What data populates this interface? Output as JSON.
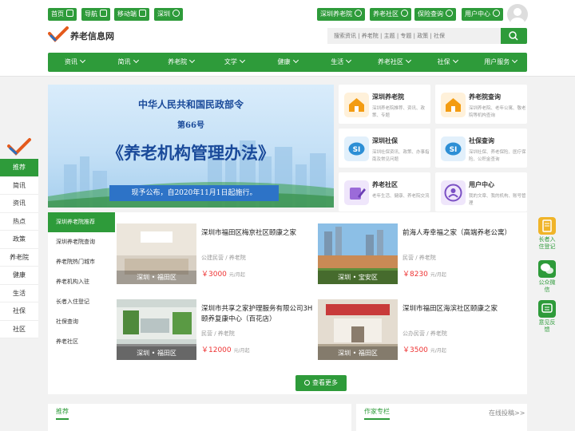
{
  "top": {
    "left_buttons": [
      {
        "label": "首页",
        "icon": "home-icon"
      },
      {
        "label": "导航",
        "icon": "grid-icon"
      },
      {
        "label": "移动端",
        "icon": "phone-icon"
      },
      {
        "label": "深圳",
        "icon": "location-icon"
      }
    ],
    "right_buttons": [
      {
        "label": "深圳养老院",
        "icon": "link-icon"
      },
      {
        "label": "养老社区",
        "icon": "link-icon"
      },
      {
        "label": "保险查询",
        "icon": "link-icon"
      },
      {
        "label": "用户中心",
        "icon": "link-icon"
      }
    ]
  },
  "logo": {
    "text": "养老信息网"
  },
  "search": {
    "placeholder": "搜索资讯 | 养老院 | 主题 | 专题 | 政策 | 社保"
  },
  "nav": [
    "资讯",
    "简讯",
    "养老院",
    "文学",
    "健康",
    "生活",
    "养老社区",
    "社保",
    "用户服务"
  ],
  "banner": {
    "line1": "中华人民共和国民政部令",
    "line2": "第66号",
    "line3": "《养老机构管理办法》",
    "line4": "现予公布，自2020年11月1日起施行。"
  },
  "cards": [
    {
      "title": "深圳养老院",
      "desc": "深圳养老院推荐、资讯、政策、专题",
      "icon": "house-icon"
    },
    {
      "title": "养老院查询",
      "desc": "深圳养老院、老年公寓、敬老院等机构查询",
      "icon": "house-icon"
    },
    {
      "title": "深圳社保",
      "desc": "深圳社保资讯、政策、办事指南及常见问题",
      "icon": "si-icon"
    },
    {
      "title": "社保查询",
      "desc": "深圳社保、养老保险、医疗保险、公积金查询",
      "icon": "si-icon"
    },
    {
      "title": "养老社区",
      "desc": "老年生活、健康、养老院交流",
      "icon": "edit-icon"
    },
    {
      "title": "用户中心",
      "desc": "我的文章、我的机构、账号管理",
      "icon": "user-icon"
    }
  ],
  "sidebar": [
    "推荐",
    "简讯",
    "资讯",
    "热点",
    "政策",
    "养老院",
    "健康",
    "生活",
    "社保",
    "社区"
  ],
  "leftmenu": [
    "深圳养老院推荐",
    "深圳养老院查询",
    "养老院热门城市",
    "养老机构入驻",
    "长者入住登记",
    "社保查询",
    "养老社区"
  ],
  "listings": [
    {
      "name": "深圳市福田区梅京社区颐康之家",
      "type": "公建民营 / 养老院",
      "price": "￥3000",
      "unit": "元/月起",
      "location": "深圳 • 福田区"
    },
    {
      "name": "前海人寿幸福之家（高端养老公寓）",
      "type": "民营 / 养老院",
      "price": "￥8230",
      "unit": "元/月起",
      "location": "深圳 • 宝安区"
    },
    {
      "name": "深圳市共享之家护理服务有限公司3H颐养复康中心（百花店）",
      "type": "民营 / 养老院",
      "price": "￥12000",
      "unit": "元/月起",
      "location": "深圳 • 福田区"
    },
    {
      "name": "深圳市福田区海滨社区颐康之家",
      "type": "公办民营 / 养老院",
      "price": "￥3500",
      "unit": "元/月起",
      "location": "深圳 • 福田区"
    }
  ],
  "more_button": "查看更多",
  "right_float": [
    {
      "label": "长者入住登记",
      "icon": "register-icon"
    },
    {
      "label": "公众微信",
      "icon": "wechat-icon"
    },
    {
      "label": "意见反馈",
      "icon": "feedback-icon"
    }
  ],
  "bottom": {
    "tab1": "推荐",
    "tab2": "作家专栏",
    "tab2_link": "在线投稿>>"
  },
  "colors": {
    "accent": "#2e9b3a",
    "price": "#ee3333"
  }
}
